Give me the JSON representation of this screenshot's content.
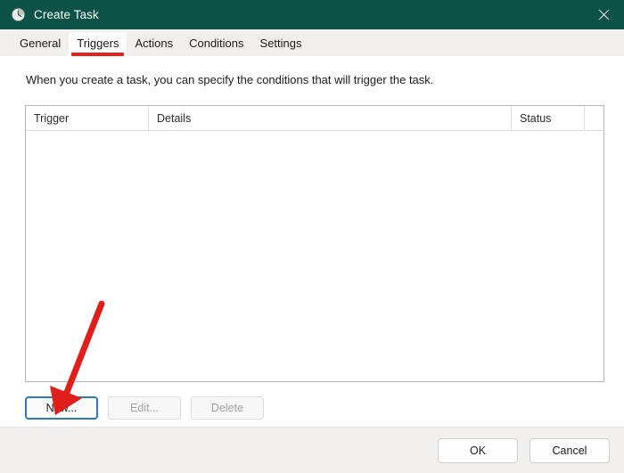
{
  "window": {
    "title": "Create Task",
    "title_icon": "clock-icon",
    "close_icon": "close-icon",
    "titlebar_color": "#0c5246"
  },
  "tabs": [
    {
      "label": "General",
      "active": false
    },
    {
      "label": "Triggers",
      "active": true
    },
    {
      "label": "Actions",
      "active": false
    },
    {
      "label": "Conditions",
      "active": false
    },
    {
      "label": "Settings",
      "active": false
    }
  ],
  "page": {
    "description": "When you create a task, you can specify the conditions that will trigger the task."
  },
  "list": {
    "columns": [
      {
        "key": "trigger",
        "label": "Trigger"
      },
      {
        "key": "details",
        "label": "Details"
      },
      {
        "key": "status",
        "label": "Status"
      }
    ],
    "rows": []
  },
  "actions": {
    "new_label": "New...",
    "edit_label": "Edit...",
    "delete_label": "Delete"
  },
  "footer": {
    "ok_label": "OK",
    "cancel_label": "Cancel"
  },
  "annotation": {
    "arrow_color": "#e01f1c",
    "arrow_target": "new-button"
  }
}
